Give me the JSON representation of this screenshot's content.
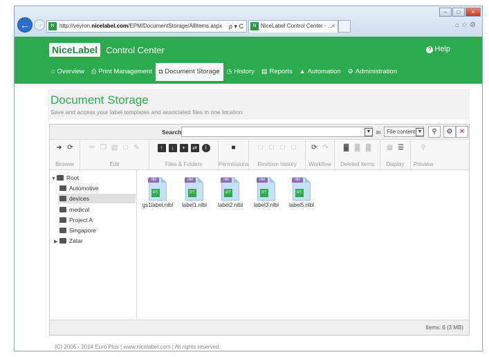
{
  "browser": {
    "url_prefix": "http://veyron.",
    "url_host": "nicelabel.com",
    "url_path": "/EPM/DocumentStorage/AllItems.aspx",
    "address_controls": "ρ ▾ C",
    "tab_title": "NiceLabel Control Center - ...",
    "tab_close": "×",
    "window_minimize": "–",
    "window_maximize": "□",
    "window_close": "×",
    "toolbar_icons": "⌂☆⚙"
  },
  "header": {
    "logo": "NiceLabel",
    "product": "Control Center",
    "help": "Help",
    "nav": [
      {
        "label": "Overview",
        "icon": "home-icon",
        "glyph": "⌂"
      },
      {
        "label": "Print Management",
        "icon": "printer-icon",
        "glyph": "⎙"
      },
      {
        "label": "Document Storage",
        "icon": "storage-icon",
        "glyph": "◘"
      },
      {
        "label": "History",
        "icon": "history-icon",
        "glyph": "◷"
      },
      {
        "label": "Reports",
        "icon": "reports-icon",
        "glyph": "▤"
      },
      {
        "label": "Automation",
        "icon": "automation-icon",
        "glyph": "▲"
      },
      {
        "label": "Administration",
        "icon": "administration-icon",
        "glyph": "⚙"
      }
    ],
    "active_nav": "Document Storage"
  },
  "page": {
    "title": "Document Storage",
    "subtitle": "Save and access your label templates and associated files in one location."
  },
  "search": {
    "label": "Search:",
    "value": "",
    "in_label": "in",
    "scope": "File content"
  },
  "toolbar": {
    "groups": [
      {
        "label": "Browse"
      },
      {
        "label": "Edit"
      },
      {
        "label": "Files & Folders"
      },
      {
        "label": "Permissions"
      },
      {
        "label": "Revision history"
      },
      {
        "label": "Workflow"
      },
      {
        "label": "Deleted items"
      },
      {
        "label": "Display"
      },
      {
        "label": "Preview"
      }
    ]
  },
  "tree": {
    "root": "Root",
    "items": [
      "Automotive",
      "devices",
      "medical",
      "Project A",
      "Singapore",
      "Zatar"
    ],
    "selected": "devices"
  },
  "files": {
    "items": [
      "gs1label.nlbl",
      "label1.nlbl",
      "label2.nlbl",
      "label3.nlbl",
      "label5.nlbl"
    ],
    "tag": "nlbl",
    "badge": "PT"
  },
  "status": {
    "items": "Items: 6 (3 MB)"
  },
  "footer": {
    "text": "(C) 2006 - 2014 Euro Plus  |  www.nicelabel.com  |  All rights reserved."
  },
  "colors": {
    "brand_green": "#2bab4d"
  }
}
